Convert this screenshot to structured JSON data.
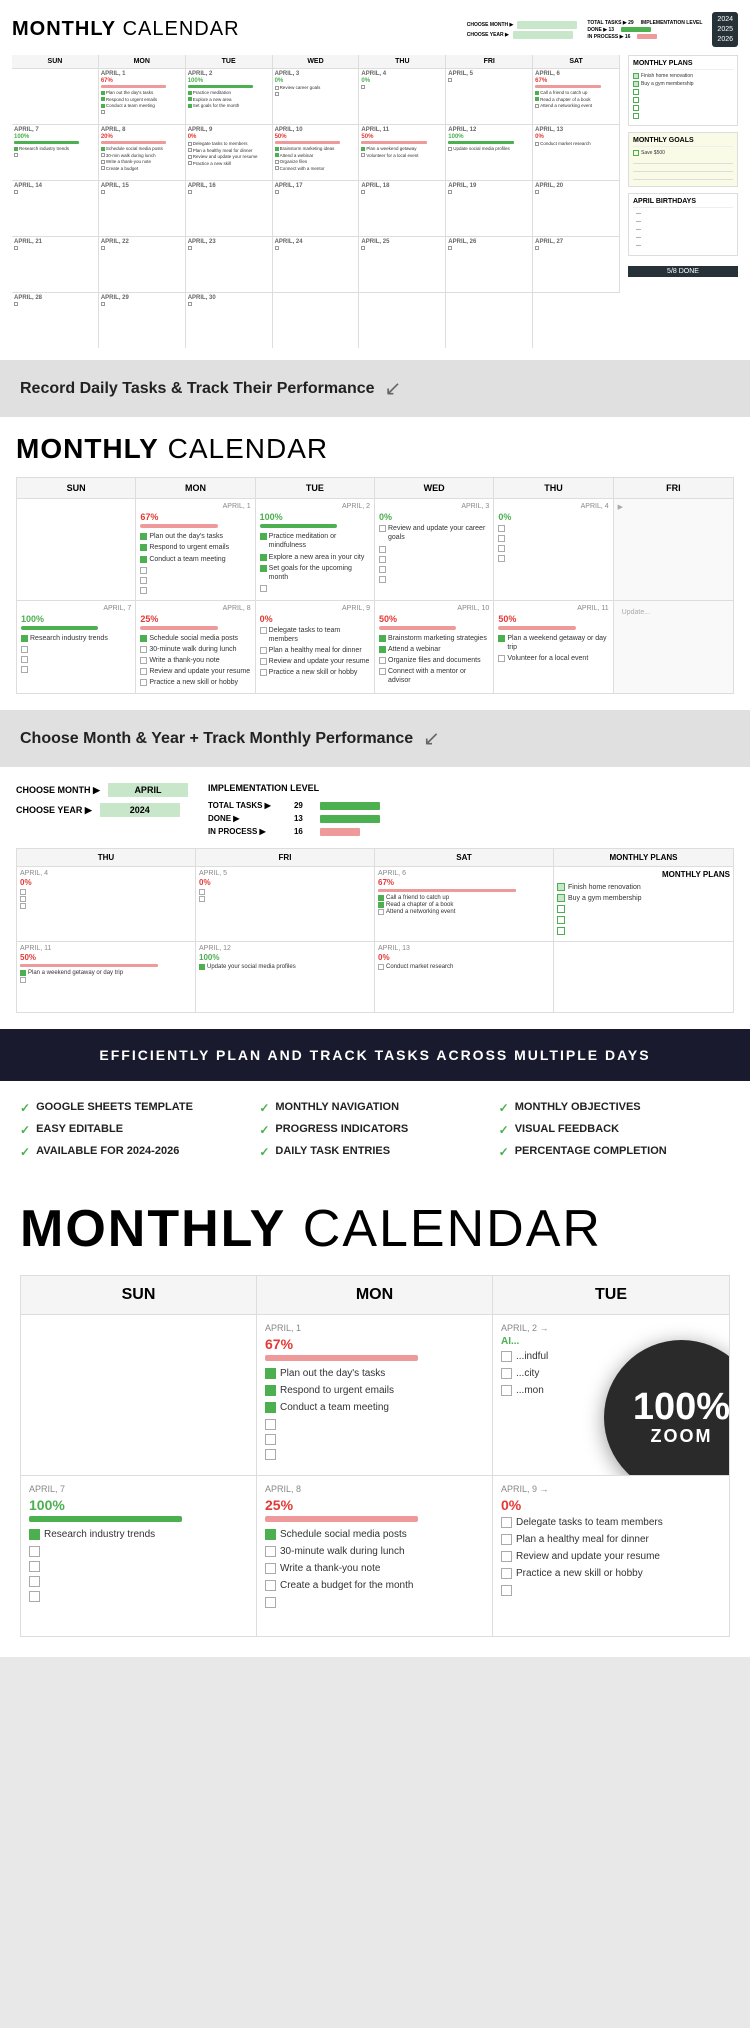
{
  "app": {
    "title": "MONTHLY",
    "title_suffix": " CALENDAR"
  },
  "controls": {
    "choose_month_label": "CHOOSE MONTH ▶",
    "choose_year_label": "CHOOSE YEAR ▶",
    "month_value": "APRIL",
    "year_value": "2024"
  },
  "stats": {
    "total_tasks_label": "TOTAL TASKS ▶",
    "done_label": "DONE ▶",
    "in_process_label": "IN PROCESS ▶",
    "total_tasks_num": "29",
    "done_num": "13",
    "in_process_num": "16",
    "impl_level_label": "IMPLEMENTATION LEVEL"
  },
  "year_badge": {
    "lines": [
      "2024",
      "2025",
      "2026"
    ]
  },
  "days": [
    "SUN",
    "MON",
    "TUE",
    "WED",
    "THU",
    "FRI",
    "SAT"
  ],
  "days6": [
    "SUN",
    "MON",
    "TUE",
    "WED",
    "THU",
    "FRI"
  ],
  "days3": [
    "SUN",
    "MON",
    "TUE"
  ],
  "monthly_plans_title": "MONTHLY PLANS",
  "monthly_plans": [
    {
      "text": "Finish home renovation",
      "checked": true
    },
    {
      "text": "Buy a gym membership",
      "checked": true
    },
    {
      "text": "",
      "checked": false
    },
    {
      "text": "",
      "checked": false
    },
    {
      "text": "",
      "checked": false
    },
    {
      "text": "",
      "checked": false
    }
  ],
  "monthly_goals_title": "MONTHLY GOALS",
  "monthly_goals": [
    {
      "text": "Save $500",
      "checked": false
    }
  ],
  "april_birthdays_title": "APRIL BIRTHDAYS",
  "done_banner": "5/8 DONE",
  "divider1": {
    "text": "Record Daily Tasks & Track Their Performance"
  },
  "divider2": {
    "text": "Choose Month & Year + Track Monthly Performance"
  },
  "dark_banner": {
    "text": "EFFICIENTLY PLAN AND TRACK TASKS ACROSS MULTIPLE DAYS"
  },
  "features": [
    {
      "label": "GOOGLE SHEETS TEMPLATE"
    },
    {
      "label": "MONTHLY NAVIGATION"
    },
    {
      "label": "MONTHLY OBJECTIVES"
    },
    {
      "label": "EASY EDITABLE"
    },
    {
      "label": "PROGRESS INDICATORS"
    },
    {
      "label": "VISUAL FEEDBACK"
    },
    {
      "label": "AVAILABLE FOR 2024-2026"
    },
    {
      "label": "DAILY TASK ENTRIES"
    },
    {
      "label": "PERCENTAGE COMPLETION"
    }
  ],
  "zoom_badge": {
    "percent": "100%",
    "label": "ZOOM"
  },
  "week1": {
    "cells": [
      {
        "date": "",
        "pct": "",
        "pct_class": "",
        "bar": "",
        "tasks": []
      },
      {
        "date": "APRIL, 1",
        "pct": "67%",
        "pct_class": "red",
        "bar": "pink",
        "tasks": [
          {
            "checked": true,
            "text": "Plan out the day's tasks"
          },
          {
            "checked": true,
            "text": "Respond to urgent emails"
          },
          {
            "checked": true,
            "text": "Conduct a team meeting"
          },
          {
            "checked": false,
            "text": ""
          },
          {
            "checked": false,
            "text": ""
          },
          {
            "checked": false,
            "text": ""
          }
        ]
      },
      {
        "date": "APRIL, 2",
        "pct": "100%",
        "pct_class": "green",
        "bar": "green",
        "tasks": [
          {
            "checked": true,
            "text": "Practice meditation or mindfulness"
          },
          {
            "checked": true,
            "text": "Explore a new area in your city"
          },
          {
            "checked": true,
            "text": "Set goals for the upcoming month"
          },
          {
            "checked": false,
            "text": ""
          },
          {
            "checked": false,
            "text": ""
          },
          {
            "checked": false,
            "text": ""
          }
        ]
      },
      {
        "date": "APRIL, 3",
        "pct": "0%",
        "pct_class": "green",
        "bar": "",
        "tasks": [
          {
            "checked": false,
            "text": "Review and update your career goals"
          },
          {
            "checked": false,
            "text": ""
          },
          {
            "checked": false,
            "text": ""
          },
          {
            "checked": false,
            "text": ""
          },
          {
            "checked": false,
            "text": ""
          },
          {
            "checked": false,
            "text": ""
          }
        ]
      },
      {
        "date": "APRIL, 4",
        "pct": "0%",
        "pct_class": "green",
        "bar": "",
        "tasks": [
          {
            "checked": false,
            "text": ""
          },
          {
            "checked": false,
            "text": ""
          },
          {
            "checked": false,
            "text": ""
          },
          {
            "checked": false,
            "text": ""
          },
          {
            "checked": false,
            "text": ""
          },
          {
            "checked": false,
            "text": ""
          }
        ]
      },
      {
        "date": "APRIL, 5",
        "pct": "",
        "pct_class": "",
        "bar": "",
        "tasks": []
      },
      {
        "date": "APRIL, 6",
        "pct": "67%",
        "pct_class": "red",
        "bar": "pink",
        "tasks": [
          {
            "checked": true,
            "text": "Call a friend to catch up"
          },
          {
            "checked": true,
            "text": "Read a chapter of a book"
          },
          {
            "checked": false,
            "text": "Attend a networking event"
          },
          {
            "checked": false,
            "text": ""
          },
          {
            "checked": false,
            "text": ""
          },
          {
            "checked": false,
            "text": ""
          }
        ]
      }
    ]
  },
  "week2_tasks": {
    "april7": [
      {
        "checked": true,
        "text": "Research industry trends"
      },
      {
        "checked": false,
        "text": ""
      },
      {
        "checked": false,
        "text": ""
      },
      {
        "checked": false,
        "text": ""
      },
      {
        "checked": false,
        "text": ""
      }
    ],
    "april8": [
      {
        "checked": true,
        "text": "Schedule social media posts"
      },
      {
        "checked": false,
        "text": "30-minute walk during lunch"
      },
      {
        "checked": false,
        "text": "Write a thank-you note"
      },
      {
        "checked": false,
        "text": "Create a budget for the month"
      },
      {
        "checked": false,
        "text": ""
      }
    ],
    "april9": [
      {
        "checked": false,
        "text": "Delegate tasks to team members"
      },
      {
        "checked": false,
        "text": "Plan a healthy meal for dinner"
      },
      {
        "checked": false,
        "text": "Review and update your resume"
      },
      {
        "checked": false,
        "text": "Practice a new skill or hobby"
      },
      {
        "checked": false,
        "text": ""
      }
    ]
  }
}
